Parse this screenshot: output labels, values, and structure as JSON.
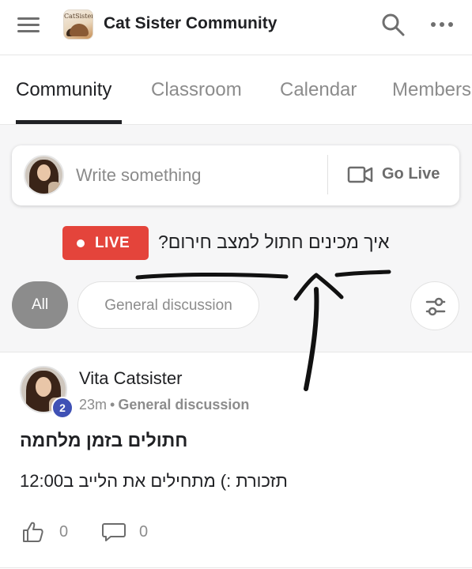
{
  "header": {
    "app_title": "Cat Sister Community",
    "logo_text": "CatSister",
    "icons": [
      "menu-icon",
      "search-icon",
      "more-icon"
    ]
  },
  "tabs": [
    {
      "label": "Community",
      "active": true
    },
    {
      "label": "Classroom",
      "active": false
    },
    {
      "label": "Calendar",
      "active": false
    },
    {
      "label": "Members",
      "active": false
    }
  ],
  "composer": {
    "placeholder": "Write something",
    "go_live_label": "Go Live"
  },
  "live": {
    "badge_label": "LIVE",
    "title": "איך מכינים חתול למצב חירום?",
    "accent_color": "#e4443b"
  },
  "filters": {
    "chips": [
      "All",
      "General discussion"
    ],
    "selected": "All"
  },
  "post": {
    "author": "Vita Catsister",
    "level": "2",
    "time": "23m",
    "separator": "•",
    "category": "General discussion",
    "title": "חתולים בזמן מלחמה",
    "body": "תזכורת :) מתחילים את הלייב ב12:00",
    "likes": "0",
    "comments": "0"
  },
  "colors": {
    "level_badge": "#3f51b5",
    "chip_selected": "#8c8c8c",
    "text_primary": "#202124",
    "text_muted": "#8c8c8c"
  }
}
